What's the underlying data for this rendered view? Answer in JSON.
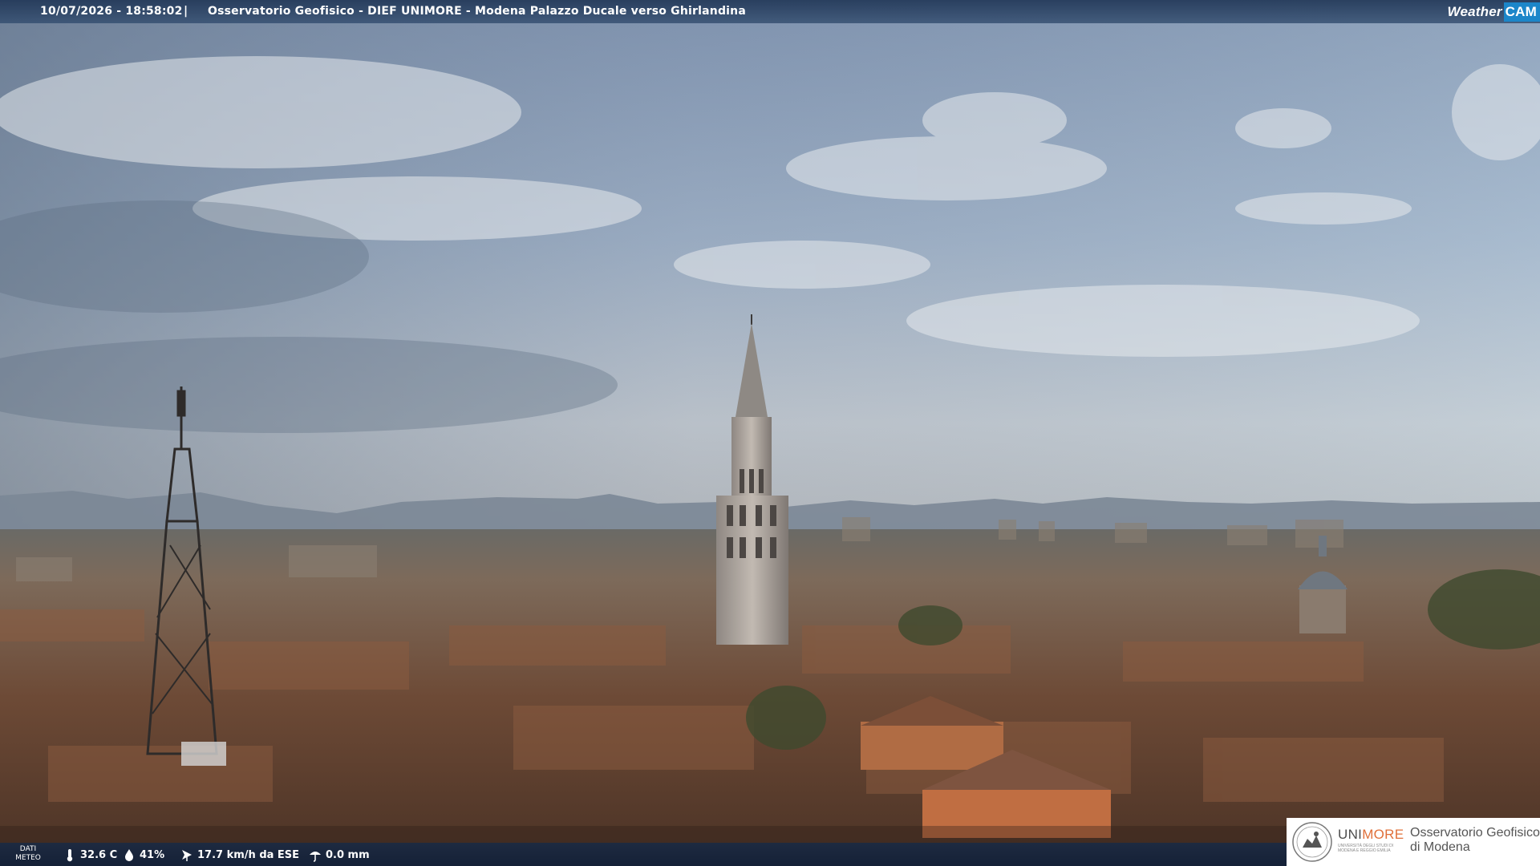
{
  "overlay": {
    "timestamp": "10/07/2026 - 18:58:02",
    "separator": "|",
    "title": "Osservatorio Geofisico - DIEF UNIMORE - Modena Palazzo Ducale verso Ghirlandina",
    "brand_word": "Weather",
    "brand_cam": "CAM"
  },
  "weather": {
    "label_line1": "DATI",
    "label_line2": "METEO",
    "temperature": "32.6 C",
    "humidity": "41%",
    "wind": "17.7 km/h da ESE",
    "rain": "0.0 mm"
  },
  "logo": {
    "uni_part1": "UNI",
    "uni_part2": "MORE",
    "uni_sub": "UNIVERSITÀ DEGLI STUDI DI MODENA E REGGIO EMILIA",
    "obs_line1": "Osservatorio Geofisico",
    "obs_line2": "di Modena"
  },
  "colors": {
    "brand_blue": "#1c86c9",
    "unimore_orange": "#e0703a"
  }
}
